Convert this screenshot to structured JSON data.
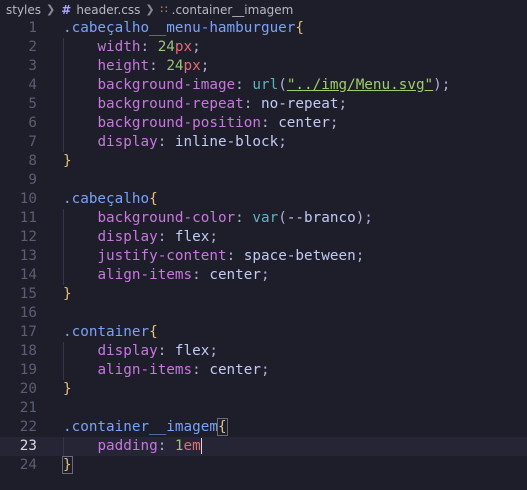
{
  "breadcrumb": {
    "folder": "styles",
    "file": "header.css",
    "symbol": ".container__imagem"
  },
  "icons": {
    "separator": "chevron-right-icon",
    "file": "css-hash-icon",
    "symbol": "css-selector-icon"
  },
  "editor": {
    "active_line": 23,
    "lines": [
      {
        "n": "1",
        "sel": ".cabeçalho__menu-hamburguer",
        "open": "{"
      },
      {
        "n": "2",
        "prop": "width",
        "num": "24",
        "unit": "px",
        "end": ";"
      },
      {
        "n": "3",
        "prop": "height",
        "num": "24",
        "unit": "px",
        "end": ";"
      },
      {
        "n": "4",
        "prop": "background-image",
        "func": "url",
        "str": "\"../img/Menu.svg\"",
        "end": ");"
      },
      {
        "n": "5",
        "prop": "background-repeat",
        "val": "no-repeat",
        "end": ";"
      },
      {
        "n": "6",
        "prop": "background-position",
        "val": "center",
        "end": ";"
      },
      {
        "n": "7",
        "prop": "display",
        "val": "inline-block",
        "end": ";"
      },
      {
        "n": "8",
        "close": "}"
      },
      {
        "n": "9"
      },
      {
        "n": "10",
        "sel": ".cabeçalho",
        "open": "{"
      },
      {
        "n": "11",
        "prop": "background-color",
        "func": "var",
        "val": "--branco",
        "end": ");"
      },
      {
        "n": "12",
        "prop": "display",
        "val": "flex",
        "end": ";"
      },
      {
        "n": "13",
        "prop": "justify-content",
        "val": "space-between",
        "end": ";"
      },
      {
        "n": "14",
        "prop": "align-items",
        "val": "center",
        "end": ";"
      },
      {
        "n": "15",
        "close": "}"
      },
      {
        "n": "16"
      },
      {
        "n": "17",
        "sel": ".container",
        "open": "{"
      },
      {
        "n": "18",
        "prop": "display",
        "val": "flex",
        "end": ";"
      },
      {
        "n": "19",
        "prop": "align-items",
        "val": "center",
        "end": ";"
      },
      {
        "n": "20",
        "close": "}"
      },
      {
        "n": "21"
      },
      {
        "n": "22",
        "sel": ".container__imagem",
        "open": "{"
      },
      {
        "n": "23",
        "prop": "padding",
        "num": "1",
        "unit": "em"
      },
      {
        "n": "24",
        "close": "}"
      }
    ]
  }
}
